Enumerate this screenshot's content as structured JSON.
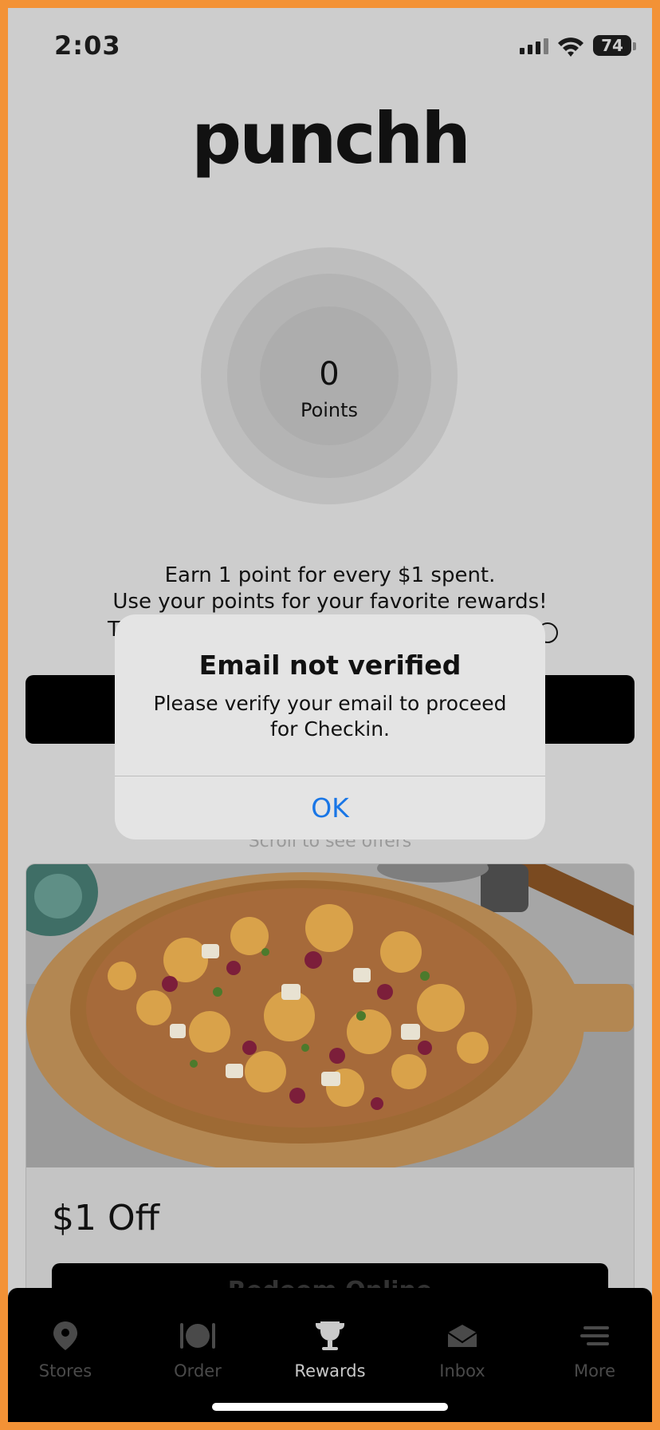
{
  "status_bar": {
    "time": "2:03",
    "battery": "74"
  },
  "brand": {
    "logo_text": "punchh"
  },
  "points": {
    "value": "0",
    "label": "Points"
  },
  "info": {
    "line1": "Earn 1 point for every $1 spent.",
    "line2": "Use your points for your favorite rewards!",
    "line3": "T"
  },
  "offers": {
    "scroll_hint": "Scroll to see offers"
  },
  "offer_card": {
    "title": "$1 Off",
    "redeem_label": "Redeem Online"
  },
  "tabs": [
    {
      "label": "Stores",
      "icon": "map-pin-icon"
    },
    {
      "label": "Order",
      "icon": "plate-icon"
    },
    {
      "label": "Rewards",
      "icon": "trophy-icon"
    },
    {
      "label": "Inbox",
      "icon": "envelope-icon"
    },
    {
      "label": "More",
      "icon": "menu-icon"
    }
  ],
  "active_tab": "Rewards",
  "alert": {
    "title": "Email not verified",
    "message": "Please verify your email to proceed for Checkin.",
    "ok_label": "OK"
  },
  "colors": {
    "frame": "#F39236",
    "accent_link": "#1976E6",
    "tab_bar": "#000000"
  }
}
